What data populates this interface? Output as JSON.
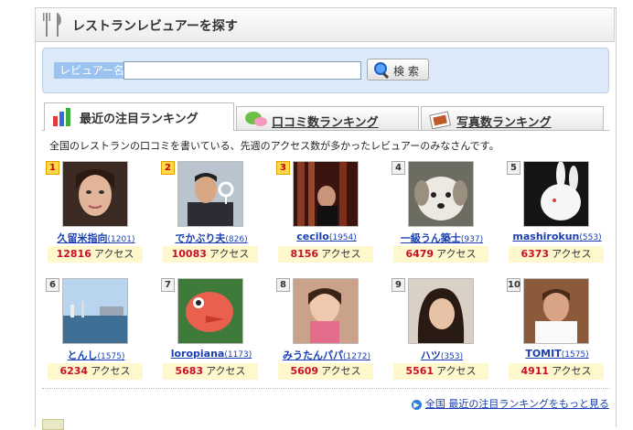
{
  "header": {
    "title": "レストランレビュアーを探す"
  },
  "search": {
    "label": "レビュアー名",
    "value": "",
    "button_label": "検 索"
  },
  "tabs": [
    {
      "label": "最近の注目ランキング",
      "active": true
    },
    {
      "label": "口コミ数ランキング",
      "active": false
    },
    {
      "label": "写真数ランキング",
      "active": false
    }
  ],
  "description": "全国のレストランの口コミを書いている、先週のアクセス数が多かったレビュアーのみなさんです。",
  "access_suffix": "アクセス",
  "reviewers": [
    {
      "rank": "1",
      "name": "久留米指向",
      "count": "(1201)",
      "access": "12816"
    },
    {
      "rank": "2",
      "name": "でかぶり夫",
      "count": "(826)",
      "access": "10083"
    },
    {
      "rank": "3",
      "name": "cecilo",
      "count": "(1954)",
      "access": "8156"
    },
    {
      "rank": "4",
      "name": "一級うん築士",
      "count": "(937)",
      "access": "6479"
    },
    {
      "rank": "5",
      "name": "mashirokun",
      "count": "(553)",
      "access": "6373"
    },
    {
      "rank": "6",
      "name": "とんし",
      "count": "(1575)",
      "access": "6234"
    },
    {
      "rank": "7",
      "name": "loropiana",
      "count": "(1173)",
      "access": "5683"
    },
    {
      "rank": "8",
      "name": "みうたんパパ",
      "count": "(1272)",
      "access": "5609"
    },
    {
      "rank": "9",
      "name": "ハツ",
      "count": "(353)",
      "access": "5561"
    },
    {
      "rank": "10",
      "name": "TOMIT",
      "count": "(1575)",
      "access": "4911"
    }
  ],
  "more_link": "全国 最近の注目ランキングをもっと見る",
  "colors": {
    "accent_link": "#1a3fb0",
    "access_number": "#c8102e",
    "search_bg": "#dbe9f9"
  }
}
